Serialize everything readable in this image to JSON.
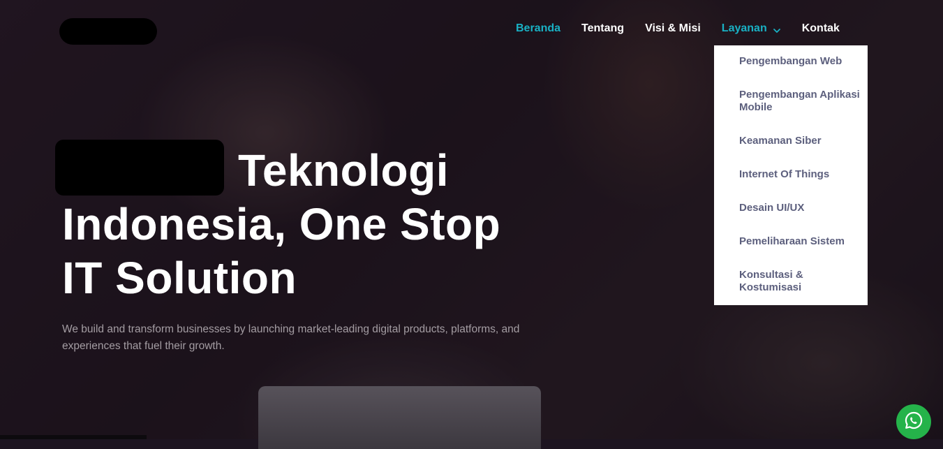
{
  "nav": {
    "items": [
      {
        "label": "Beranda"
      },
      {
        "label": "Tentang"
      },
      {
        "label": "Visi & Misi"
      },
      {
        "label": "Layanan"
      },
      {
        "label": "Kontak"
      }
    ]
  },
  "dropdown": {
    "items": [
      {
        "label": "Pengembangan Web"
      },
      {
        "label": "Pengembangan Aplikasi Mobile"
      },
      {
        "label": "Keamanan Siber"
      },
      {
        "label": "Internet Of Things"
      },
      {
        "label": "Desain UI/UX"
      },
      {
        "label": "Pemeliharaan Sistem"
      },
      {
        "label": "Konsultasi & Kostumisasi"
      }
    ]
  },
  "hero": {
    "headline_rest": "Teknologi Indonesia, One Stop IT Solution",
    "subtext": "We build and transform businesses by launching market-leading digital products, platforms, and experiences that fuel their growth."
  },
  "icons": {
    "dropdown_chevron": "chevron-down-icon",
    "whatsapp": "whatsapp-icon"
  },
  "colors": {
    "accent": "#19b1c4",
    "dropdown_text": "#5c5f7d",
    "whatsapp": "#25b34a"
  }
}
